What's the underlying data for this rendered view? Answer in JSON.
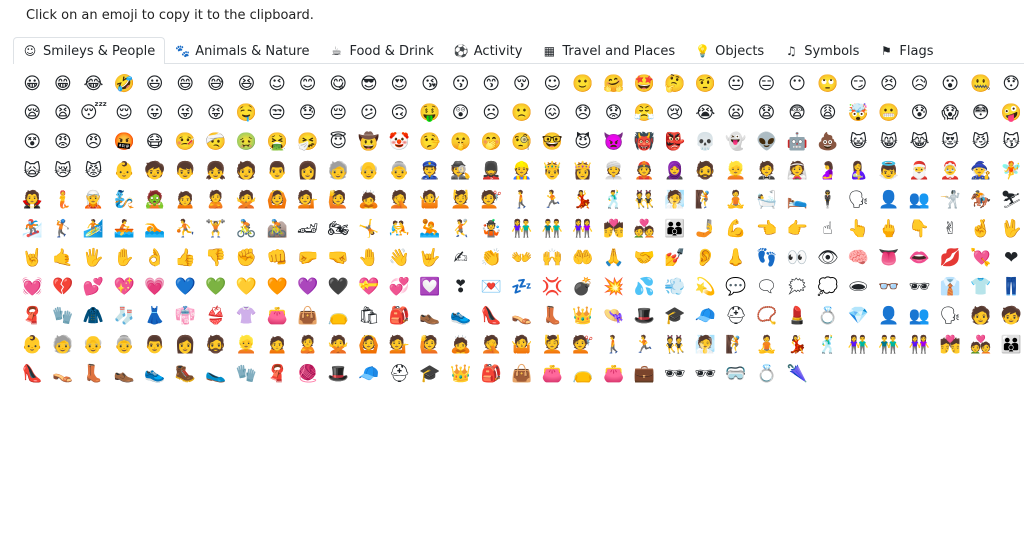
{
  "instruction": "Click on an emoji to copy it to the clipboard.",
  "tabs": [
    {
      "label": "Smileys & People",
      "icon": "☺",
      "icon_name": "smiley-icon",
      "active": true
    },
    {
      "label": "Animals & Nature",
      "icon": "🐾",
      "icon_name": "paw-icon",
      "active": false
    },
    {
      "label": "Food & Drink",
      "icon": "☕",
      "icon_name": "coffee-icon",
      "active": false
    },
    {
      "label": "Activity",
      "icon": "⚽",
      "icon_name": "soccer-ball-icon",
      "active": false
    },
    {
      "label": "Travel and Places",
      "icon": "▦",
      "icon_name": "building-icon",
      "active": false
    },
    {
      "label": "Objects",
      "icon": "💡",
      "icon_name": "lightbulb-icon",
      "active": false
    },
    {
      "label": "Symbols",
      "icon": "♫",
      "icon_name": "music-note-icon",
      "active": false
    },
    {
      "label": "Flags",
      "icon": "⚑",
      "icon_name": "flag-icon",
      "active": false
    }
  ],
  "emoji_rows": [
    [
      "😀",
      "😁",
      "😂",
      "🤣",
      "😃",
      "😄",
      "😅",
      "😆",
      "😉",
      "😊",
      "😋",
      "😎",
      "😍",
      "😘",
      "😗",
      "😙",
      "😚",
      "☺",
      "🙂",
      "🤗",
      "🤩",
      "🤔",
      "🤨",
      "😐",
      "😑",
      "😶",
      "🙄",
      "😏",
      "😣",
      "😥",
      "😮",
      "🤐",
      "😯"
    ],
    [
      "😪",
      "😫",
      "😴",
      "😌",
      "😛",
      "😜",
      "😝",
      "🤤",
      "😒",
      "😓",
      "😔",
      "😕",
      "🙃",
      "🤑",
      "😲",
      "☹",
      "🙁",
      "😖",
      "😞",
      "😟",
      "😤",
      "😢",
      "😭",
      "😦",
      "😧",
      "😨",
      "😩",
      "🤯",
      "😬",
      "😰",
      "😱",
      "😳",
      "🤪"
    ],
    [
      "😵",
      "😡",
      "😠",
      "🤬",
      "😷",
      "🤒",
      "🤕",
      "🤢",
      "🤮",
      "🤧",
      "😇",
      "🤠",
      "🤡",
      "🤥",
      "🤫",
      "🤭",
      "🧐",
      "🤓",
      "😈",
      "👿",
      "👹",
      "👺",
      "💀",
      "👻",
      "👽",
      "🤖",
      "💩",
      "😺",
      "😸",
      "😹",
      "😻",
      "😼",
      "😽"
    ],
    [
      "🙀",
      "😿",
      "😾",
      "👶",
      "🧒",
      "👦",
      "👧",
      "🧑",
      "👨",
      "👩",
      "🧓",
      "👴",
      "👵",
      "👮",
      "🕵",
      "💂",
      "👷",
      "🤴",
      "👸",
      "👳",
      "👲",
      "🧕",
      "🧔",
      "👱",
      "🤵",
      "👰",
      "🤰",
      "🤱",
      "👼",
      "🎅",
      "🤶",
      "🧙",
      "🧚"
    ],
    [
      "🧛",
      "🧜",
      "🧝",
      "🧞",
      "🧟",
      "🙍",
      "🙎",
      "🙅",
      "🙆",
      "💁",
      "🙋",
      "🙇",
      "🤦",
      "🤷",
      "💆",
      "💇",
      "🚶",
      "🏃",
      "💃",
      "🕺",
      "👯",
      "🧖",
      "🧗",
      "🧘",
      "🛀",
      "🛌",
      "🕴",
      "🗣",
      "👤",
      "👥",
      "🤺",
      "🏇",
      "⛷"
    ],
    [
      "🏂",
      "🏌",
      "🏄",
      "🚣",
      "🏊",
      "⛹",
      "🏋",
      "🚴",
      "🚵",
      "🏎",
      "🏍",
      "🤸",
      "🤼",
      "🤽",
      "🤾",
      "🤹",
      "👫",
      "👬",
      "👭",
      "💏",
      "💑",
      "👪",
      "🤳",
      "💪",
      "👈",
      "👉",
      "☝",
      "👆",
      "🖕",
      "👇",
      "✌",
      "🤞",
      "🖖"
    ],
    [
      "🤘",
      "🤙",
      "🖐",
      "✋",
      "👌",
      "👍",
      "👎",
      "✊",
      "👊",
      "🤛",
      "🤜",
      "🤚",
      "👋",
      "🤟",
      "✍",
      "👏",
      "👐",
      "🙌",
      "🤲",
      "🙏",
      "🤝",
      "💅",
      "👂",
      "👃",
      "👣",
      "👀",
      "👁",
      "🧠",
      "👅",
      "👄",
      "💋",
      "💘",
      "❤"
    ],
    [
      "💓",
      "💔",
      "💕",
      "💖",
      "💗",
      "💙",
      "💚",
      "💛",
      "🧡",
      "💜",
      "🖤",
      "💝",
      "💞",
      "💟",
      "❣",
      "💌",
      "💤",
      "💢",
      "💣",
      "💥",
      "💦",
      "💨",
      "💫",
      "💬",
      "🗨",
      "🗯",
      "💭",
      "🕳",
      "👓",
      "🕶",
      "👔",
      "👕",
      "👖"
    ],
    [
      "🧣",
      "🧤",
      "🧥",
      "🧦",
      "👗",
      "👘",
      "👙",
      "👚",
      "👛",
      "👜",
      "👝",
      "🛍",
      "🎒",
      "👞",
      "👟",
      "👠",
      "👡",
      "👢",
      "👑",
      "👒",
      "🎩",
      "🎓",
      "🧢",
      "⛑",
      "📿",
      "💄",
      "💍",
      "💎",
      "👤",
      "👥",
      "🗣",
      "🧑",
      "🧒"
    ],
    [
      "👶",
      "🧓",
      "👴",
      "👵",
      "👨",
      "👩",
      "🧔",
      "👱",
      "🙍",
      "🙎",
      "🙅",
      "🙆",
      "💁",
      "🙋",
      "🙇",
      "🤦",
      "🤷",
      "💆",
      "💇",
      "🚶",
      "🏃",
      "👯",
      "🧖",
      "🧗",
      "🧘",
      "💃",
      "🕺",
      "👫",
      "👬",
      "👭",
      "💏",
      "💑",
      "👪"
    ],
    [
      "👠",
      "👡",
      "👢",
      "👞",
      "👟",
      "🥾",
      "🥿",
      "🧤",
      "🧣",
      "🧶",
      "🎩",
      "🧢",
      "⛑",
      "🎓",
      "👑",
      "🎒",
      "👜",
      "👛",
      "👝",
      "👛",
      "💼",
      "🕶",
      "🕶",
      "🥽",
      "💍",
      "🌂"
    ]
  ]
}
